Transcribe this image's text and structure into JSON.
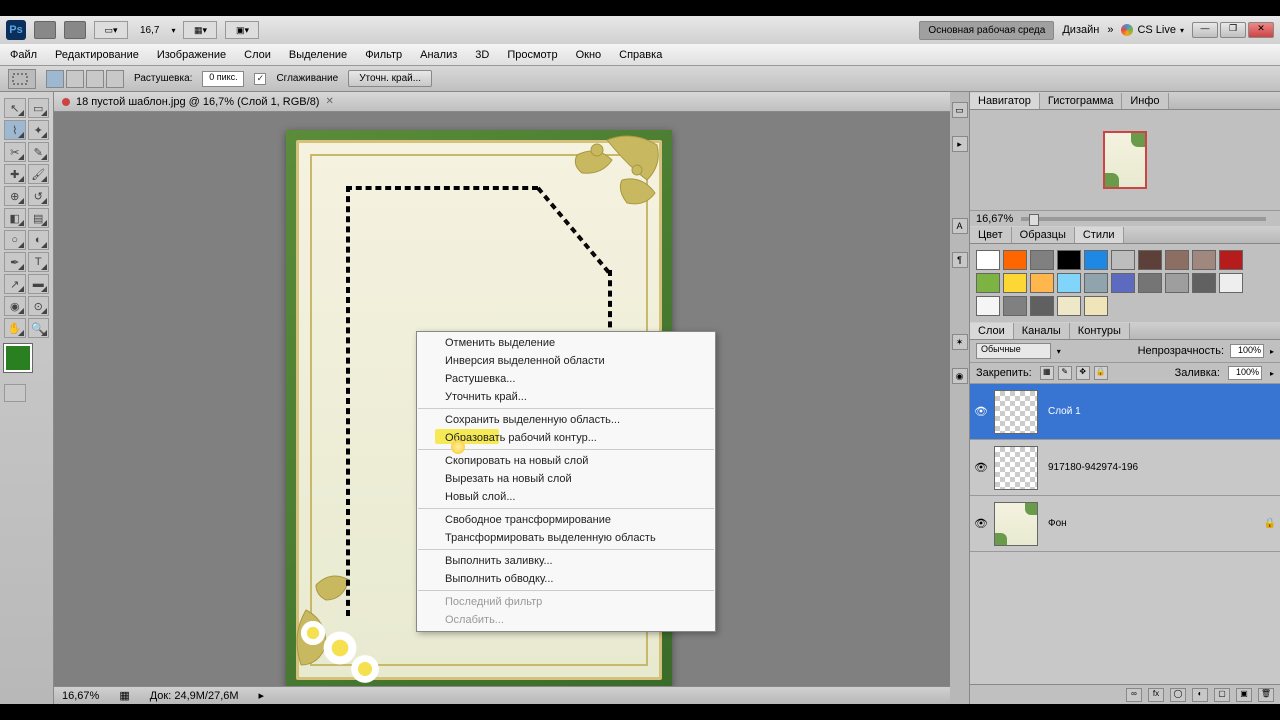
{
  "titlebar": {
    "zoom": "16,7",
    "workspace_btn": "Основная рабочая среда",
    "design_btn": "Дизайн",
    "more": "»",
    "cslive": "CS Live"
  },
  "menu": [
    "Файл",
    "Редактирование",
    "Изображение",
    "Слои",
    "Выделение",
    "Фильтр",
    "Анализ",
    "3D",
    "Просмотр",
    "Окно",
    "Справка"
  ],
  "options": {
    "feather_label": "Растушевка:",
    "feather_value": "0 пикс.",
    "antialias": "Сглаживание",
    "refine": "Уточн. край..."
  },
  "doc_tab": "18 пустой шаблон.jpg @ 16,7% (Слой 1, RGB/8)",
  "status": {
    "zoom": "16,67%",
    "doc": "Док: 24,9М/27,6М"
  },
  "context_menu": {
    "groups": [
      [
        "Отменить выделение",
        "Инверсия выделенной области",
        "Растушевка...",
        "Уточнить край..."
      ],
      [
        "Сохранить выделенную область...",
        "Образовать рабочий контур..."
      ],
      [
        "Скопировать на новый слой",
        "Вырезать на новый слой",
        "Новый слой..."
      ],
      [
        "Свободное трансформирование",
        "Трансформировать выделенную область"
      ],
      [
        "Выполнить заливку...",
        "Выполнить обводку..."
      ],
      [
        "Последний фильтр",
        "Ослабить..."
      ]
    ],
    "disabled": [
      "Последний фильтр",
      "Ослабить..."
    ],
    "highlight": "Образовать рабочий контур..."
  },
  "panels": {
    "nav_tabs": [
      "Навигатор",
      "Гистограмма",
      "Инфо"
    ],
    "nav_zoom": "16,67%",
    "color_tabs": [
      "Цвет",
      "Образцы",
      "Стили"
    ],
    "swatches": [
      "#ffffff",
      "#ff6600",
      "#808080",
      "#000000",
      "#1e88e5",
      "#bdbdbd",
      "#5d4037",
      "#8d6e63",
      "#a1887f",
      "#b71c1c",
      "#7cb342",
      "#fdd835",
      "#ffb74d",
      "#81d4fa",
      "#90a4ae",
      "#5c6bc0",
      "#757575",
      "#9e9e9e",
      "#616161",
      "#eeeeee",
      "#f5f5f5",
      "#808080",
      "#606060",
      "#efe8c8",
      "#efe5b8"
    ],
    "layer_tabs": [
      "Слои",
      "Каналы",
      "Контуры"
    ],
    "blend": "Обычные",
    "opacity_label": "Непрозрачность:",
    "opacity": "100%",
    "lock_label": "Закрепить:",
    "fill_label": "Заливка:",
    "fill": "100%",
    "layers": [
      {
        "name": "Слой 1",
        "selected": true,
        "bg": false,
        "locked": false
      },
      {
        "name": "917180-942974-196",
        "selected": false,
        "bg": false,
        "locked": false
      },
      {
        "name": "Фон",
        "selected": false,
        "bg": true,
        "locked": true
      }
    ]
  }
}
